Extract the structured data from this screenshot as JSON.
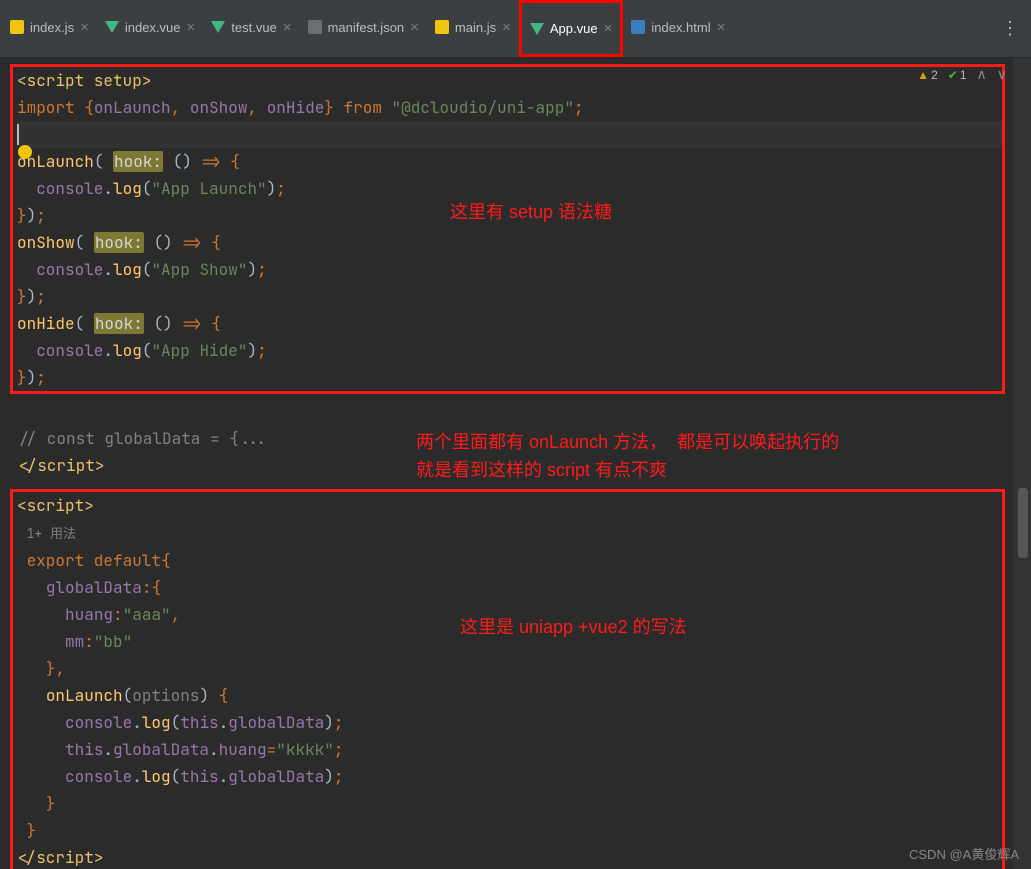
{
  "tabs": [
    {
      "label": "index.js",
      "icon": "js",
      "active": false
    },
    {
      "label": "index.vue",
      "icon": "vue",
      "active": false
    },
    {
      "label": "test.vue",
      "icon": "vue",
      "active": false
    },
    {
      "label": "manifest.json",
      "icon": "json",
      "active": false
    },
    {
      "label": "main.js",
      "icon": "js",
      "active": false
    },
    {
      "label": "App.vue",
      "icon": "vue",
      "active": true
    },
    {
      "label": "index.html",
      "icon": "html",
      "active": false
    }
  ],
  "status": {
    "warn": "2",
    "ok": "1"
  },
  "annotations": {
    "a1": "这里有 setup 语法糖",
    "a2": "两个里面都有 onLaunch 方法，  都是可以唤起执行的\n就是看到这样的 script 有点不爽",
    "a3": "这里是 uniapp +vue2 的写法"
  },
  "code": {
    "scriptSetupOpen": "script setup",
    "importKw": "import",
    "importNames": "onLaunch",
    "importNames2": "onShow",
    "importNames3": "onHide",
    "fromKw": "from",
    "importPkg": "\"@dcloudio/uni-app\"",
    "hook": "hook:",
    "onLaunch": "onLaunch",
    "onShow": "onShow",
    "onHide": "onHide",
    "console": "console",
    "log": "log",
    "appLaunch": "\"App Launch\"",
    "appShow": "\"App Show\"",
    "appHide": "\"App Hide\"",
    "commentGlobal": "// const globalData = {...",
    "scriptClose": "script",
    "scriptOpen2": "script",
    "usage": "1+ 用法",
    "exportDefault": "export default",
    "globalDataKey": "globalData",
    "huangKey": "huang",
    "huangVal": "\"aaa\"",
    "mmKey": "mm",
    "mmVal": "\"bb\"",
    "onLaunch2": "onLaunch",
    "options": "options",
    "thisKw": "this",
    "globalDataRef": "globalData",
    "huangRef": "huang",
    "kkkk": "\"kkkk\""
  },
  "watermark": "CSDN @A黄俊辉A"
}
